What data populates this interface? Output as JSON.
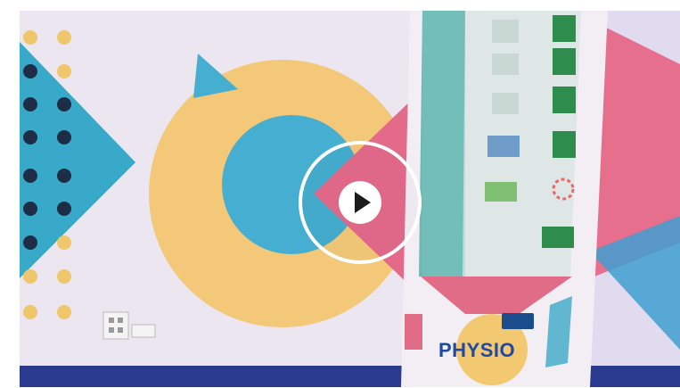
{
  "player": {
    "play_icon": "play-icon",
    "accent": "#ffffff"
  },
  "kiosk": {
    "brand": "PHYSIO",
    "sponsor_line": "",
    "sponsor_label": "",
    "sponsor_logo": ""
  },
  "colors": {
    "wall": "#e9e4ee",
    "yellow": "#f2c56f",
    "teal": "#3ba9c6",
    "pink": "#e76a8c",
    "floor": "#2a3a8e"
  }
}
